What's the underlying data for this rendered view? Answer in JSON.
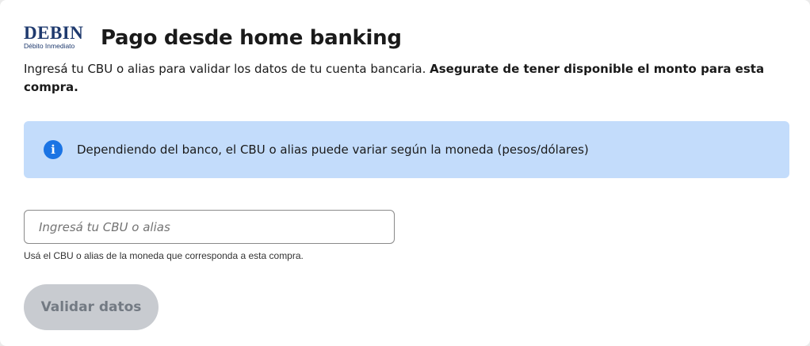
{
  "header": {
    "logo_word": "DEBIN",
    "logo_sub": "Débito Inmediato",
    "title": "Pago desde home banking"
  },
  "intro": {
    "text": "Ingresá tu CBU o alias para validar los datos de tu cuenta bancaria.",
    "bold_text": "Asegurate de tener disponible el monto para esta compra."
  },
  "info_banner": {
    "icon": "info-icon",
    "icon_glyph": "i",
    "text": "Dependiendo del banco, el CBU o alias puede variar según la moneda (pesos/dólares)"
  },
  "cbu_field": {
    "value": "",
    "placeholder": "Ingresá tu CBU o alias",
    "helper": "Usá el CBU o alias de la moneda que corresponda a esta compra."
  },
  "validate_button": {
    "label": "Validar datos",
    "disabled": true
  },
  "colors": {
    "brand_navy": "#1f3a6e",
    "info_bg": "#c3dcfb",
    "info_icon": "#1b74e4",
    "button_disabled_bg": "#c8cbd0",
    "button_disabled_text": "#737a83"
  }
}
